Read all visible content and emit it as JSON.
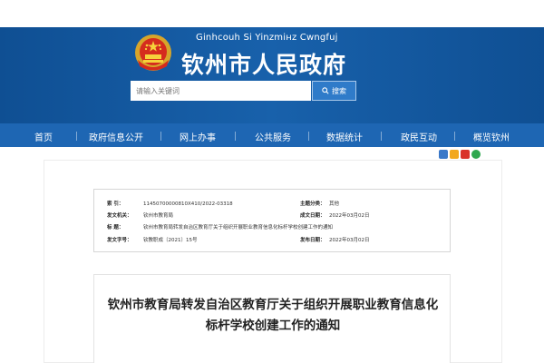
{
  "header": {
    "subtitle": "Ginhcouh Si Yinzmінz Cwngfuj",
    "title": "钦州市人民政府"
  },
  "search": {
    "placeholder": "请输入关键词",
    "button_label": "搜索"
  },
  "nav": {
    "items": [
      "首页",
      "政府信息公开",
      "网上办事",
      "公共服务",
      "数据统计",
      "政民互动",
      "概览钦州"
    ]
  },
  "share": {
    "icons": [
      "share-plus-icon",
      "qzone-icon",
      "weibo-icon",
      "wechat-icon"
    ],
    "colors": [
      "#3a78c8",
      "#f2a81f",
      "#d9332a",
      "#2fa84f"
    ]
  },
  "meta": {
    "index_label": "索  引：",
    "index_value": "11450700000810X410/2022-03318",
    "subject_label": "主题分类：",
    "subject_value": "其他",
    "issuer_label": "发文机关：",
    "issuer_value": "钦州市教育局",
    "date_label": "成文日期：",
    "date_value": "2022年03月02日",
    "title_label": "标    题：",
    "title_value": "钦州市教育局转发自治区教育厅关于组织开展职业教育信息化标杆学校创建工作的通知",
    "number_label": "发文字号：",
    "number_value": "钦教职成〔2021〕15号",
    "pubdate_label": "发布日期：",
    "pubdate_value": "2022年03月02日"
  },
  "article": {
    "title": "钦州市教育局转发自治区教育厅关于组织开展职业教育信息化标杆学校创建工作的通知"
  }
}
